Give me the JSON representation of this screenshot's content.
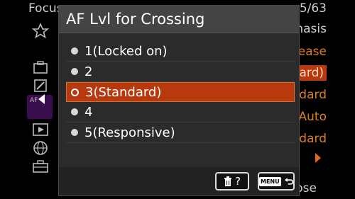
{
  "background": {
    "title_fragment": "Focus",
    "page_indicator": "5/63",
    "side_items": [
      "star-icon",
      "camera-icon",
      "pen-icon",
      "af-icon",
      "play-icon",
      "globe-icon",
      "toolbox-icon"
    ],
    "side_active_label": "AF",
    "right_fragments": [
      {
        "text": "hasis",
        "style": "normal"
      },
      {
        "text": "lease",
        "style": "orange"
      },
      {
        "text": "dard)",
        "style": "selected"
      },
      {
        "text": "ndard",
        "style": "orange"
      },
      {
        "text": "Auto",
        "style": "orange"
      },
      {
        "text": "ndard",
        "style": "orange"
      }
    ],
    "bottom_fragment": "ose"
  },
  "dialog": {
    "title": "AF Lvl for Crossing",
    "options": [
      {
        "label": "1(Locked on)",
        "selected": false
      },
      {
        "label": "2",
        "selected": false
      },
      {
        "label": "3(Standard)",
        "selected": true
      },
      {
        "label": "4",
        "selected": false
      },
      {
        "label": "5(Responsive)",
        "selected": false
      }
    ],
    "footer": {
      "delete_help_label": "?",
      "menu_label": "MENU"
    }
  },
  "colors": {
    "accent_selected": "#b8390e",
    "accent_orange": "#e07d1f",
    "dialog_bg": "#2b2b2b",
    "header_bg": "#444444"
  }
}
